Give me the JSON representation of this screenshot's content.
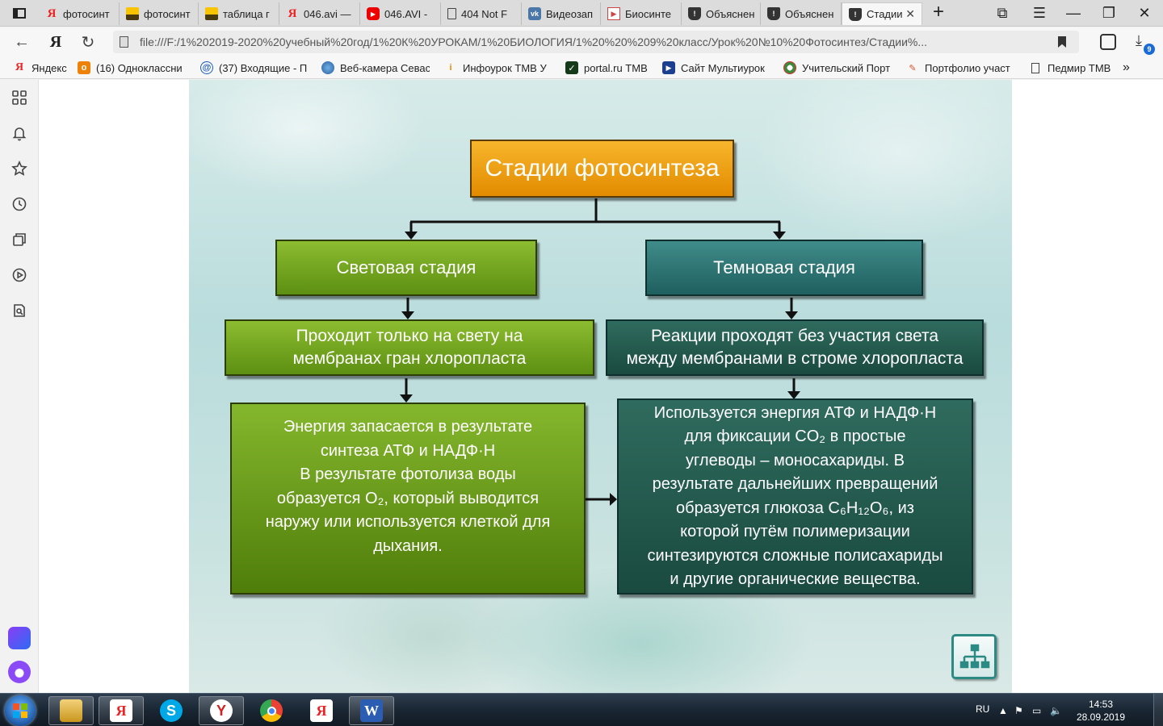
{
  "browser": {
    "tabs": [
      {
        "label": "фотосинт",
        "icon": "yandex-icon"
      },
      {
        "label": "фотосинт",
        "icon": "image-icon"
      },
      {
        "label": "таблица г",
        "icon": "image-icon"
      },
      {
        "label": "046.avi —",
        "icon": "yandex-icon"
      },
      {
        "label": "046.AVI - ",
        "icon": "youtube-icon"
      },
      {
        "label": "404 Not F",
        "icon": "document-icon"
      },
      {
        "label": "Видеозап",
        "icon": "vk-icon"
      },
      {
        "label": "Биосинте",
        "icon": "presentation-icon"
      },
      {
        "label": "Объяснен",
        "icon": "shield-icon"
      },
      {
        "label": "Объяснен",
        "icon": "shield-icon"
      },
      {
        "label": "Стадии",
        "icon": "shield-icon",
        "active": true
      }
    ],
    "address": "file:///F:/1%202019-2020%20учебный%20год/1%20К%20УРОКАМ/1%20БИОЛОГИЯ/1%20%20%209%20класс/Урок%20№10%20Фотосинтез/Стадии%...",
    "downloads_count": "9",
    "bookmarks": [
      {
        "label": "Яндекс",
        "icon": "yandex-icon"
      },
      {
        "label": "(16) Одноклассни",
        "icon": "odnoklassniki-icon"
      },
      {
        "label": "(37) Входящие - П",
        "icon": "mail-icon"
      },
      {
        "label": "Веб-камера Севас",
        "icon": "globe-icon"
      },
      {
        "label": "Инфоурок ТМВ У",
        "icon": "infourok-icon"
      },
      {
        "label": "portal.ru ТМВ",
        "icon": "check-icon"
      },
      {
        "label": "Сайт Мультиурок",
        "icon": "multiurok-icon"
      },
      {
        "label": "Учительский Порт",
        "icon": "teacher-portal-icon"
      },
      {
        "label": "Портфолио участ",
        "icon": "portfolio-icon"
      },
      {
        "label": "Педмир ТМВ",
        "icon": "document-icon"
      }
    ]
  },
  "slide": {
    "title": "Стадии фотосинтеза",
    "light_stage": "Световая стадия",
    "dark_stage": "Темновая стадия",
    "light_where": [
      "Проходит только на свету на",
      "мембранах гран хлоропласта"
    ],
    "dark_where": [
      "Реакции проходят без участия света",
      "между мембранами в строме хлоропласта"
    ],
    "light_desc": [
      "Энергия запасается в результате",
      "синтеза АТФ и НАДФ·Н",
      "В результате фотолиза воды",
      "образуется O₂, который выводится",
      "наружу или используется клеткой для",
      "дыхания."
    ],
    "dark_desc": [
      "Используется энергия АТФ и НАДФ·Н",
      "для фиксации CO₂ в простые",
      "углеводы – моносахариды. В",
      "результате дальнейших превращений",
      "образуется глюкоза C₆H₁₂O₆, из",
      "которой путём полимеризации",
      "синтезируются сложные полисахариды",
      "и другие органические вещества."
    ],
    "colors": {
      "title": "#e69a12",
      "light": "#6e9d1c",
      "dark": "#2a6f6c"
    }
  },
  "taskbar": {
    "lang": "RU",
    "time": "14:53",
    "date": "28.09.2019",
    "apps": [
      "file-manager-icon",
      "yandex-icon",
      "skype-icon",
      "yandex-browser-icon",
      "chrome-icon",
      "yandex-icon",
      "word-icon"
    ]
  }
}
